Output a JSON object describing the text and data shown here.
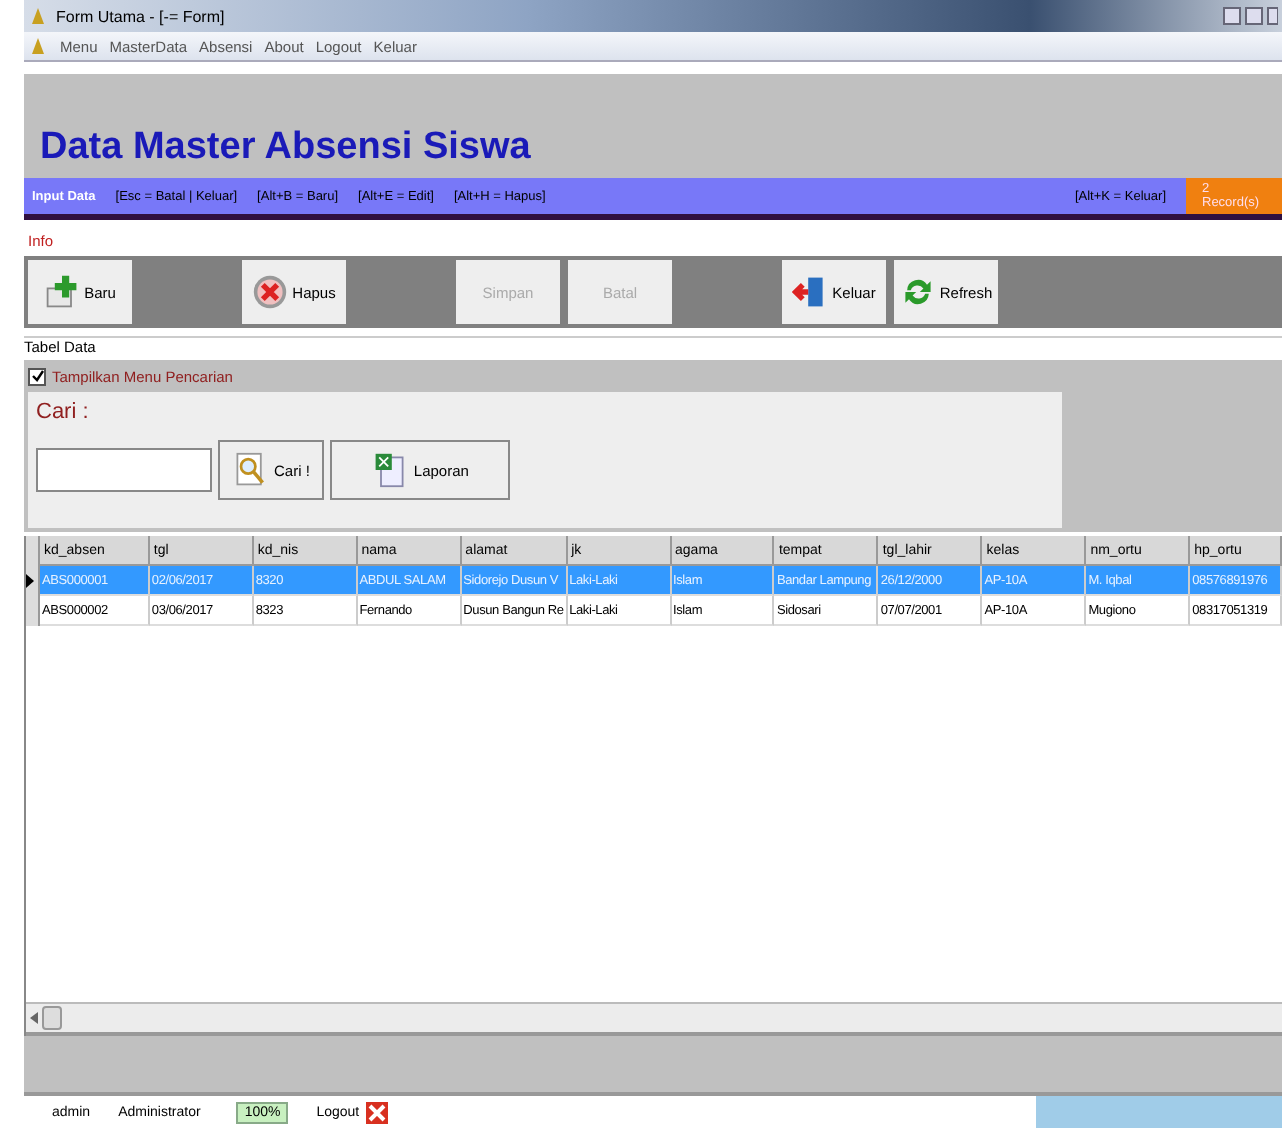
{
  "window": {
    "title": "Form Utama - [-= Form]"
  },
  "menu": [
    "Menu",
    "MasterData",
    "Absensi",
    "About",
    "Logout",
    "Keluar"
  ],
  "header": {
    "title": "Data Master Absensi Siswa"
  },
  "shortcut_bar": {
    "label": "Input Data",
    "hints_left": [
      "[Esc = Batal | Keluar]",
      "[Alt+B = Baru]",
      "[Alt+E = Edit]",
      "[Alt+H = Hapus]"
    ],
    "hint_right": "[Alt+K = Keluar]",
    "record_count": "2 Record(s)"
  },
  "info_label": "Info",
  "toolbar": [
    [
      {
        "label": "Baru",
        "kind": "add",
        "disabled": false
      }
    ],
    [
      {
        "label": "Hapus",
        "kind": "delete",
        "disabled": false
      }
    ],
    [
      {
        "label": "Simpan",
        "kind": "save",
        "disabled": true
      },
      {
        "label": "Batal",
        "kind": "cancel",
        "disabled": true
      }
    ],
    [
      {
        "label": "Keluar",
        "kind": "exit",
        "disabled": false
      },
      {
        "label": "Refresh",
        "kind": "refresh",
        "disabled": false
      }
    ]
  ],
  "table_group": {
    "title": "Tabel Data",
    "search_toggle": {
      "label": "Tampilkan Menu Pencarian",
      "checked": true
    },
    "search_label": "Cari :",
    "search_button": "Cari !",
    "report_button": "Laporan"
  },
  "table": {
    "columns": [
      "kd_absen",
      "tgl",
      "kd_nis",
      "nama",
      "alamat",
      "jk",
      "agama",
      "tempat",
      "tgl_lahir",
      "kelas",
      "nm_ortu",
      "hp_ortu"
    ],
    "rows": [
      {
        "selected": true,
        "cells": [
          "ABS000001",
          "02/06/2017",
          "8320",
          "ABDUL SALAM",
          "Sidorejo Dusun V",
          "Laki-Laki",
          "Islam",
          "Bandar Lampung",
          "26/12/2000",
          "AP-10A",
          "M. Iqbal",
          "08576891976"
        ]
      },
      {
        "selected": false,
        "cells": [
          "ABS000002",
          "03/06/2017",
          "8323",
          "Fernando",
          "Dusun Bangun Re",
          "Laki-Laki",
          "Islam",
          "Sidosari",
          "07/07/2001",
          "AP-10A",
          "Mugiono",
          "08317051319"
        ]
      }
    ]
  },
  "status_bar": {
    "user": "admin",
    "role": "Administrator",
    "zoom": "100%",
    "logout": "Logout"
  }
}
